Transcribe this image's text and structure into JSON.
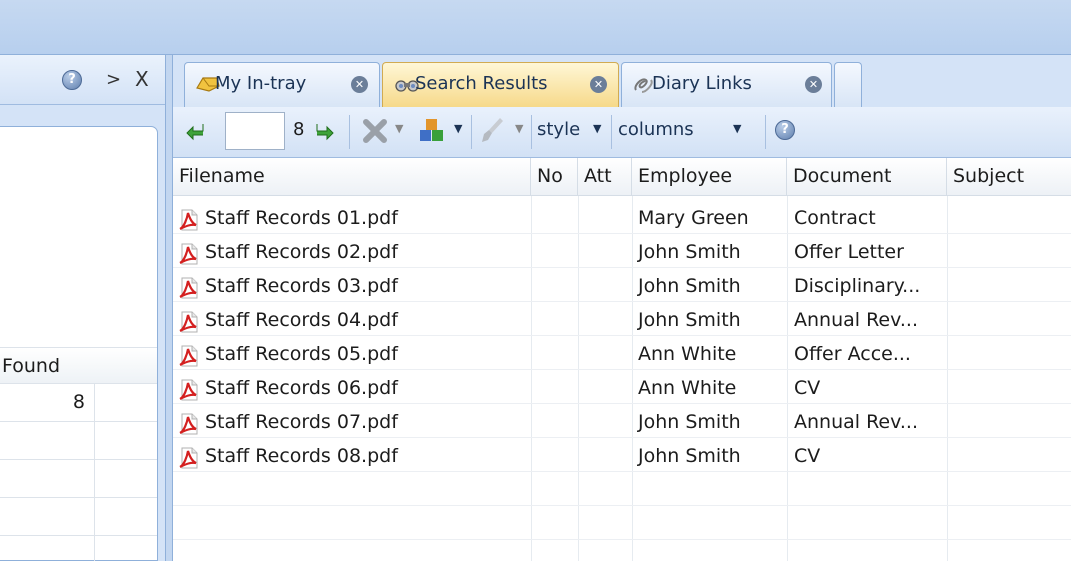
{
  "left_panel": {
    "help_icon": "help-icon",
    "chevron_label": ">",
    "close_label": "X",
    "column_header": "Found",
    "found_count": "8"
  },
  "tabs": [
    {
      "label": "My In-tray",
      "icon": "in-tray-icon",
      "active": false
    },
    {
      "label": "Search Results",
      "icon": "binoculars-icon",
      "active": true
    },
    {
      "label": "Diary Links",
      "icon": "diary-links-icon",
      "active": false
    }
  ],
  "toolbar": {
    "page_input_value": "",
    "result_count": "8",
    "style_label": "style",
    "columns_label": "columns"
  },
  "grid": {
    "columns": [
      "Filename",
      "No",
      "Att",
      "Employee",
      "Document",
      "Subject"
    ],
    "rows": [
      {
        "filename": "Staff Records 01.pdf",
        "employee": "Mary Green",
        "document": "Contract"
      },
      {
        "filename": "Staff Records 02.pdf",
        "employee": "John Smith",
        "document": "Offer Letter"
      },
      {
        "filename": "Staff Records 03.pdf",
        "employee": "John Smith",
        "document": "Disciplinary..."
      },
      {
        "filename": "Staff Records 04.pdf",
        "employee": "John Smith",
        "document": "Annual Rev..."
      },
      {
        "filename": "Staff Records 05.pdf",
        "employee": "Ann White",
        "document": "Offer Acce..."
      },
      {
        "filename": "Staff Records 06.pdf",
        "employee": "Ann White",
        "document": "CV"
      },
      {
        "filename": "Staff Records 07.pdf",
        "employee": "John Smith",
        "document": "Annual Rev..."
      },
      {
        "filename": "Staff Records 08.pdf",
        "employee": "John Smith",
        "document": "CV"
      }
    ]
  },
  "colors": {
    "accent": "#c6d9f1",
    "active_tab": "#f6d98a",
    "pdf_red": "#d42020"
  }
}
